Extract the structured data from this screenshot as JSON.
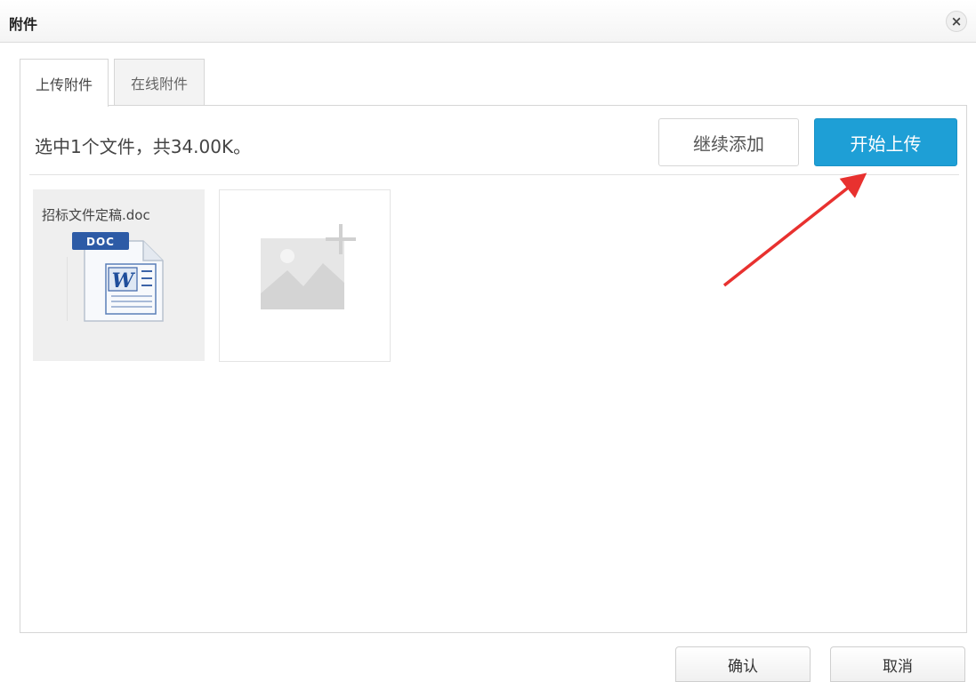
{
  "dialog": {
    "title": "附件",
    "close_label": "×"
  },
  "tabs": [
    {
      "label": "上传附件",
      "active": true
    },
    {
      "label": "在线附件",
      "active": false
    }
  ],
  "upload": {
    "status": "选中1个文件，共34.00K。",
    "add_more_label": "继续添加",
    "start_upload_label": "开始上传",
    "accent_color": "#1e9fd6"
  },
  "files": [
    {
      "name": "招标文件定稿.doc",
      "icon": "word-doc-icon",
      "badge": "DOC",
      "glyph": "W"
    }
  ],
  "add_placeholder": {
    "icon": "add-image-icon"
  },
  "annotation": {
    "color": "#e8312f"
  },
  "footer": {
    "confirm_label": "确认",
    "cancel_label": "取消"
  }
}
